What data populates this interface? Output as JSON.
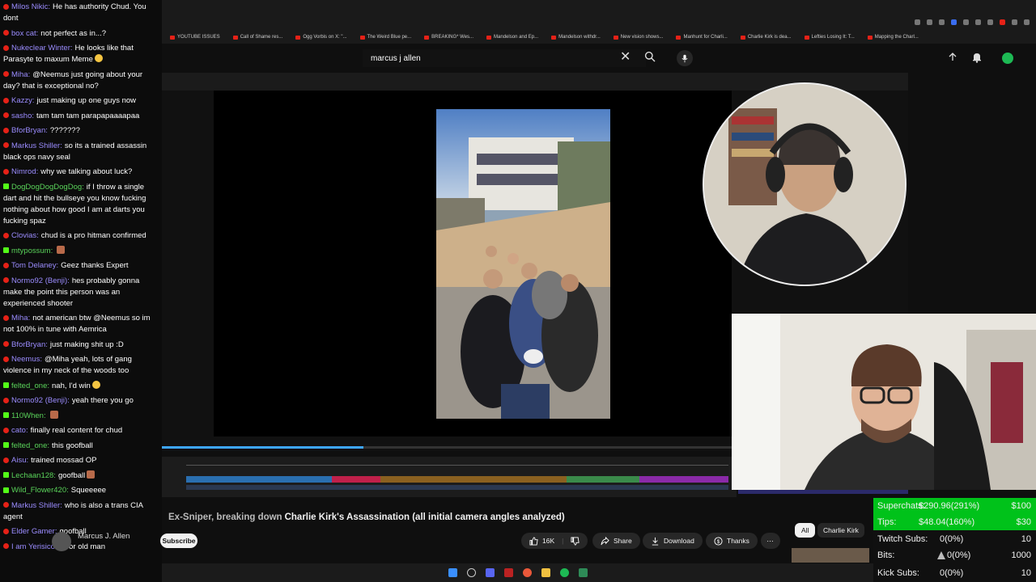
{
  "browser": {
    "bookmarks": [
      "YOUTUBE ISSUES",
      "Call of Shame res...",
      "Ogg Vorbis on X: \"...",
      "The Weird Blue pe...",
      "BREAKING* Wes...",
      "Mandelson and Ep...",
      "Mandelson withdr...",
      "New vision shows...",
      "Manhunt for Charli...",
      "Charlie Kirk is dea...",
      "Lefties Losing It: T...",
      "Mapping the Charl..."
    ]
  },
  "search": {
    "value": "marcus j allen"
  },
  "chat": {
    "messages": [
      {
        "platform": "youtube",
        "user": "Milos Nikic",
        "user_color": "#9b8cff",
        "text": "He has authority Chud. You dont"
      },
      {
        "platform": "youtube",
        "user": "box cat",
        "user_color": "#9b8cff",
        "text": "not perfect as in...?"
      },
      {
        "platform": "youtube",
        "user": "Nukeclear Winter",
        "user_color": "#9b8cff",
        "text": "He looks like that Parasyte to maxum Meme",
        "emote": "smirk"
      },
      {
        "platform": "youtube",
        "user": "Miha",
        "user_color": "#9b8cff",
        "text": "@Neemus just going about your day? that is exceptional no?"
      },
      {
        "platform": "youtube",
        "user": "Kazzy",
        "user_color": "#9b8cff",
        "text": "just making up one guys now"
      },
      {
        "platform": "youtube",
        "user": "sasho",
        "user_color": "#9b8cff",
        "text": "tam tam tam parapapaaaapaa"
      },
      {
        "platform": "youtube",
        "user": "BforBryan",
        "user_color": "#9b8cff",
        "text": "???????"
      },
      {
        "platform": "youtube",
        "user": "Markus Shiller",
        "user_color": "#9b8cff",
        "text": "so its a trained assassin black ops navy seal"
      },
      {
        "platform": "youtube",
        "user": "Nimrod",
        "user_color": "#9b8cff",
        "text": "why we talking about luck?"
      },
      {
        "platform": "kick",
        "user": "DogDogDogDogDog",
        "user_color": "#5ad45a",
        "text": "if I throw a single dart and hit the bullseye you know fucking nothing about how good I am at darts you fucking spaz"
      },
      {
        "platform": "youtube",
        "user": "Clovias",
        "user_color": "#9b8cff",
        "text": "chud is a pro hitman confirmed"
      },
      {
        "platform": "kick",
        "user": "mtypossum",
        "user_color": "#5ad45a",
        "text": "",
        "emote": "face"
      },
      {
        "platform": "youtube",
        "user": "Tom Delaney",
        "user_color": "#9b8cff",
        "text": "Geez thanks Expert"
      },
      {
        "platform": "youtube",
        "user": "Normo92 (Benji)",
        "user_color": "#9b8cff",
        "text": "hes probably gonna make the point this person was an experienced shooter"
      },
      {
        "platform": "youtube",
        "user": "Miha",
        "user_color": "#9b8cff",
        "text": "not american btw @Neemus so im not 100% in tune with Aemrica"
      },
      {
        "platform": "youtube",
        "user": "BforBryan",
        "user_color": "#9b8cff",
        "text": "just making shit up :D"
      },
      {
        "platform": "youtube",
        "user": "Neemus",
        "user_color": "#9b8cff",
        "text": "@Miha yeah, lots of gang violence in my neck of the woods too"
      },
      {
        "platform": "kick",
        "user": "felted_one",
        "user_color": "#5ad45a",
        "text": "nah, I'd win",
        "emote": "smile"
      },
      {
        "platform": "youtube",
        "user": "Normo92 (Benji)",
        "user_color": "#9b8cff",
        "text": "yeah there you go"
      },
      {
        "platform": "kick",
        "user": "110When",
        "user_color": "#5ad45a",
        "text": "",
        "emote": "face"
      },
      {
        "platform": "youtube",
        "user": "cato",
        "user_color": "#9b8cff",
        "text": "finally real content for chud"
      },
      {
        "platform": "kick",
        "user": "felted_one",
        "user_color": "#5ad45a",
        "text": "this goofball"
      },
      {
        "platform": "youtube",
        "user": "Aisu",
        "user_color": "#9b8cff",
        "text": "trained mossad OP"
      },
      {
        "platform": "kick",
        "user": "Lechaan128",
        "user_color": "#5ad45a",
        "text": "goofball",
        "emote": "face"
      },
      {
        "platform": "kick",
        "user": "Wild_Flower420",
        "user_color": "#5ad45a",
        "text": "Squeeeee"
      },
      {
        "platform": "youtube",
        "user": "Markus Shiller",
        "user_color": "#9b8cff",
        "text": "who is also a trans CIA agent"
      },
      {
        "platform": "youtube",
        "user": "Elder Gamer",
        "user_color": "#9b8cff",
        "text": "goofball"
      },
      {
        "platform": "youtube",
        "user": "I am Yerisico",
        "user_color": "#9b8cff",
        "text": "Poor old man"
      }
    ]
  },
  "video": {
    "title": "Charlie Kirk's Assassination (all initial camera angles analyzed)",
    "title_overlay": "Ex-Sniper, breaking down",
    "channel_name": "Marcus J. Allen",
    "subscribe_label": "Subscribe",
    "likes": "16K",
    "share_label": "Share",
    "download_label": "Download",
    "thanks_label": "Thanks",
    "progress": 0.27
  },
  "chips": {
    "all": "All",
    "charlie_kirk": "Charlie Kirk"
  },
  "stats": {
    "superchats_label": "Superchats:",
    "superchats_value": "$290.96(291%)",
    "superchats_goal": "$100",
    "tips_label": "Tips:",
    "tips_value": "$48.04(160%)",
    "tips_goal": "$30",
    "twitch_label": "Twitch Subs:",
    "twitch_value": "0(0%)",
    "twitch_goal": "10",
    "bits_label": "Bits:",
    "bits_value": "0(0%)",
    "bits_goal": "1000",
    "kick_label": "Kick Subs:",
    "kick_value": "0(0%)",
    "kick_goal": "10"
  },
  "colors": {
    "youtube_badge": "#e62117",
    "kick_badge": "#53fc18",
    "stats_highlight": "#00c21a",
    "progress": "#3ea6ff"
  }
}
